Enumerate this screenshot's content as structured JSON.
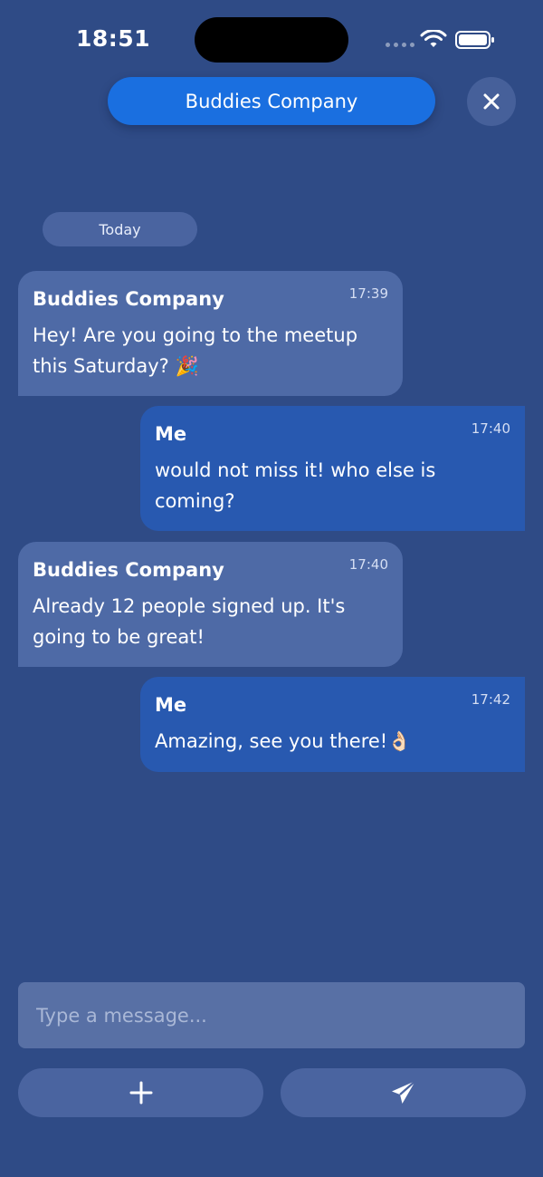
{
  "status_bar": {
    "time": "18:51"
  },
  "header": {
    "title": "Buddies Company",
    "close_icon": "close-icon"
  },
  "chat": {
    "date_label": "Today",
    "messages": [
      {
        "sender": "Buddies Company",
        "time": "17:39",
        "text": "Hey! Are you going to the meetup this Saturday? 🎉",
        "direction": "incoming"
      },
      {
        "sender": "Me",
        "time": "17:40",
        "text": "would not miss it! who else is coming?",
        "direction": "outgoing"
      },
      {
        "sender": "Buddies Company",
        "time": "17:40",
        "text": "Already 12 people signed up. It's going to be great!",
        "direction": "incoming"
      },
      {
        "sender": "Me",
        "time": "17:42",
        "text": "Amazing, see you there!👌🏻",
        "direction": "outgoing"
      }
    ]
  },
  "composer": {
    "placeholder": "Type a message...",
    "value": "",
    "add_icon": "plus-icon",
    "send_icon": "paper-plane-icon"
  },
  "colors": {
    "background": "#2f4b86",
    "accent": "#1a6fe0",
    "incoming_bubble": "#4e6aa6",
    "outgoing_bubble": "#2859b0",
    "input_background": "#5870a5"
  }
}
